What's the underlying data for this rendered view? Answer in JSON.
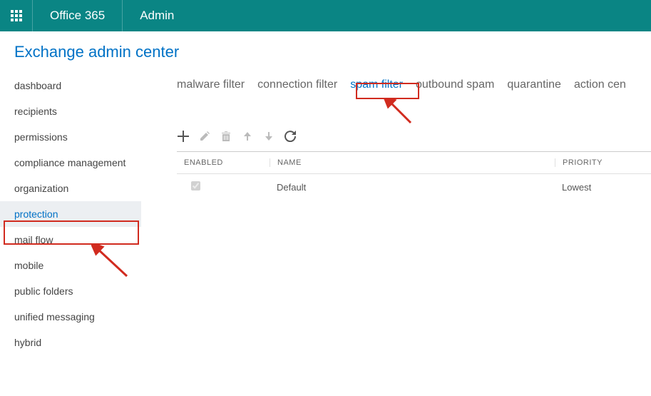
{
  "topbar": {
    "brand": "Office 365",
    "section": "Admin"
  },
  "page_title": "Exchange admin center",
  "sidebar": {
    "items": [
      {
        "label": "dashboard",
        "selected": false
      },
      {
        "label": "recipients",
        "selected": false
      },
      {
        "label": "permissions",
        "selected": false
      },
      {
        "label": "compliance management",
        "selected": false
      },
      {
        "label": "organization",
        "selected": false
      },
      {
        "label": "protection",
        "selected": true
      },
      {
        "label": "mail flow",
        "selected": false
      },
      {
        "label": "mobile",
        "selected": false
      },
      {
        "label": "public folders",
        "selected": false
      },
      {
        "label": "unified messaging",
        "selected": false
      },
      {
        "label": "hybrid",
        "selected": false
      }
    ]
  },
  "tabs": [
    {
      "label": "malware filter",
      "selected": false
    },
    {
      "label": "connection filter",
      "selected": false
    },
    {
      "label": "spam filter",
      "selected": true
    },
    {
      "label": "outbound spam",
      "selected": false
    },
    {
      "label": "quarantine",
      "selected": false
    },
    {
      "label": "action cen",
      "selected": false
    }
  ],
  "toolbar": {
    "buttons": [
      {
        "name": "add",
        "enabled": true
      },
      {
        "name": "edit",
        "enabled": false
      },
      {
        "name": "delete",
        "enabled": false
      },
      {
        "name": "move-up",
        "enabled": false
      },
      {
        "name": "move-down",
        "enabled": false
      },
      {
        "name": "refresh",
        "enabled": true
      }
    ]
  },
  "table": {
    "columns": [
      {
        "key": "enabled",
        "label": "ENABLED"
      },
      {
        "key": "name",
        "label": "NAME"
      },
      {
        "key": "priority",
        "label": "PRIORITY"
      }
    ],
    "rows": [
      {
        "enabled": true,
        "name": "Default",
        "priority": "Lowest"
      }
    ]
  },
  "annotations": {
    "highlight_sidebar": "protection",
    "highlight_tab": "spam filter"
  }
}
